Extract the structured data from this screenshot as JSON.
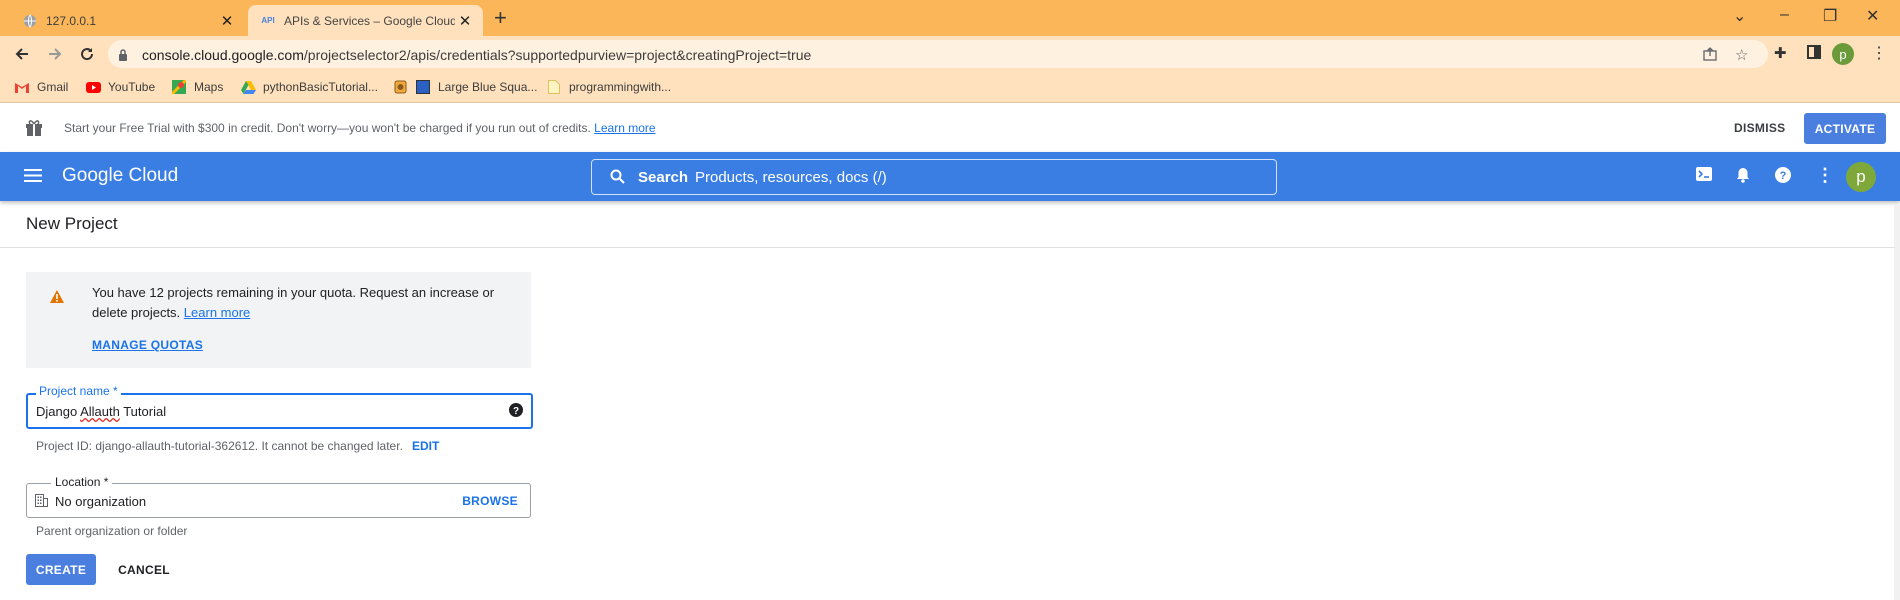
{
  "browser": {
    "tabs": [
      {
        "title": "127.0.0.1",
        "icon": "globe-icon",
        "active": false
      },
      {
        "title": "APIs & Services – Google Cloud c",
        "icon": "api-icon",
        "active": true
      }
    ],
    "url_host": "console.cloud.google.com",
    "url_path": "/projectselector2/apis/credentials?supportedpurview=project&creatingProject=true",
    "profile_initial": "p",
    "bookmarks": [
      {
        "label": "Gmail",
        "icon": "gmail-icon"
      },
      {
        "label": "YouTube",
        "icon": "youtube-icon"
      },
      {
        "label": "Maps",
        "icon": "maps-icon"
      },
      {
        "label": "pythonBasicTutorial...",
        "icon": "drive-icon"
      },
      {
        "label": "",
        "icon": "bookmark-icon"
      },
      {
        "label": "Large Blue Squa...",
        "icon": "blue-square-icon"
      },
      {
        "label": "programmingwith...",
        "icon": "folder-icon"
      }
    ]
  },
  "trial_banner": {
    "message": "Start your Free Trial with $300 in credit. Don't worry—you won't be charged if you run out of credits.",
    "link": "Learn more",
    "dismiss": "DISMISS",
    "activate": "ACTIVATE"
  },
  "header": {
    "logo": "Google Cloud",
    "search_label": "Search",
    "search_placeholder": "Products, resources, docs (/)",
    "avatar_initial": "p"
  },
  "page": {
    "title": "New Project",
    "quota": {
      "text": "You have 12 projects remaining in your quota. Request an increase or delete projects.",
      "link": "Learn more",
      "manage": "MANAGE QUOTAS"
    },
    "project_name": {
      "label": "Project name *",
      "value_prefix": "Django ",
      "value_spell": "Allauth",
      "value_suffix": " Tutorial"
    },
    "project_id": {
      "text": "Project ID: django-allauth-tutorial-362612. It cannot be changed later.",
      "edit": "EDIT"
    },
    "location": {
      "label": "Location *",
      "value": "No organization",
      "browse": "BROWSE",
      "help": "Parent organization or folder"
    },
    "create": "CREATE",
    "cancel": "CANCEL"
  },
  "colors": {
    "tabstrip": "#fbb65a",
    "toolbar": "#ffe2bd",
    "gc_blue": "#3a7ee4",
    "link_blue": "#1a73e8"
  }
}
